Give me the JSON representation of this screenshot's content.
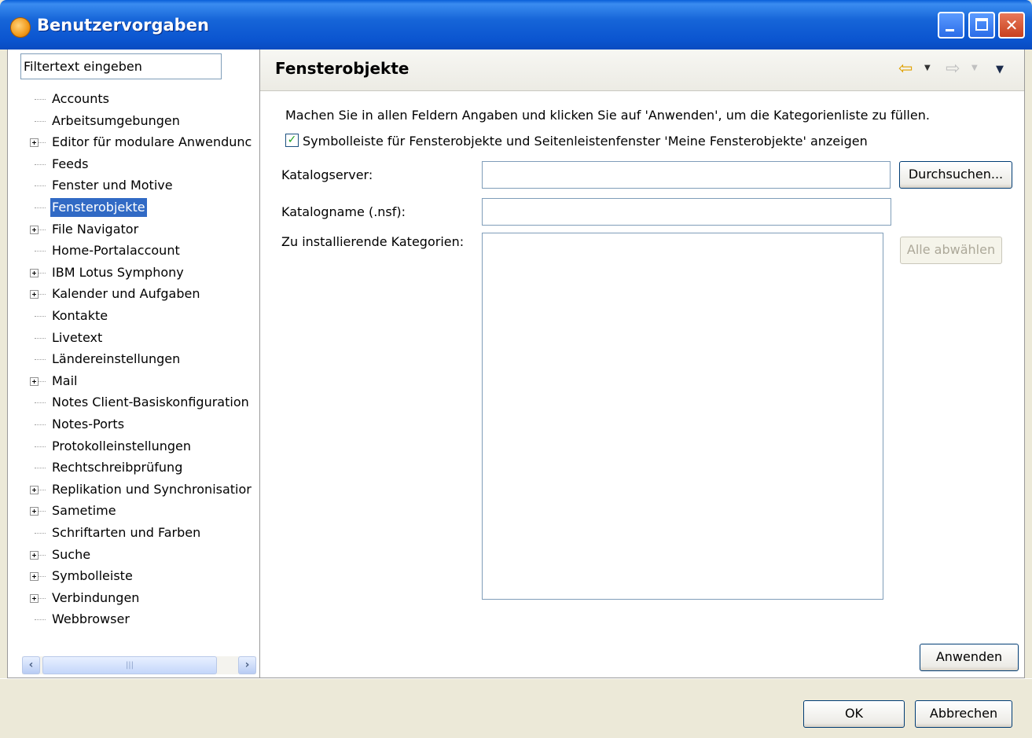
{
  "window": {
    "title": "Benutzervorgaben"
  },
  "filter": {
    "placeholder": "Filtertext eingeben"
  },
  "tree": {
    "items": [
      {
        "label": "Accounts",
        "expandable": false
      },
      {
        "label": "Arbeitsumgebungen",
        "expandable": false
      },
      {
        "label": "Editor für modulare Anwendunc",
        "expandable": true
      },
      {
        "label": "Feeds",
        "expandable": false
      },
      {
        "label": "Fenster und Motive",
        "expandable": false
      },
      {
        "label": "Fensterobjekte",
        "expandable": false,
        "selected": true
      },
      {
        "label": "File Navigator",
        "expandable": true
      },
      {
        "label": "Home-Portalaccount",
        "expandable": false
      },
      {
        "label": "IBM Lotus Symphony",
        "expandable": true
      },
      {
        "label": "Kalender und Aufgaben",
        "expandable": true
      },
      {
        "label": "Kontakte",
        "expandable": false
      },
      {
        "label": "Livetext",
        "expandable": false
      },
      {
        "label": "Ländereinstellungen",
        "expandable": false
      },
      {
        "label": "Mail",
        "expandable": true
      },
      {
        "label": "Notes Client-Basiskonfiguration",
        "expandable": false
      },
      {
        "label": "Notes-Ports",
        "expandable": false
      },
      {
        "label": "Protokolleinstellungen",
        "expandable": false
      },
      {
        "label": "Rechtschreibprüfung",
        "expandable": false
      },
      {
        "label": "Replikation und Synchronisatior",
        "expandable": true
      },
      {
        "label": "Sametime",
        "expandable": true
      },
      {
        "label": "Schriftarten und Farben",
        "expandable": false
      },
      {
        "label": "Suche",
        "expandable": true
      },
      {
        "label": "Symbolleiste",
        "expandable": true
      },
      {
        "label": "Verbindungen",
        "expandable": true
      },
      {
        "label": "Webbrowser",
        "expandable": false
      }
    ]
  },
  "page": {
    "title": "Fensterobjekte",
    "description": "Machen Sie in allen Feldern Angaben und klicken Sie auf 'Anwenden', um die Kategorienliste zu füllen.",
    "show_toolbar_checkbox": {
      "label": "Symbolleiste für Fensterobjekte und Seitenleistenfenster 'Meine Fensterobjekte' anzeigen",
      "checked": true
    },
    "catalog_server": {
      "label": "Katalogserver:",
      "value": ""
    },
    "browse_button": "Durchsuchen...",
    "catalog_name": {
      "label": "Katalogname (.nsf):",
      "value": ""
    },
    "categories": {
      "label": "Zu installierende Kategorien:",
      "items": []
    },
    "deselect_all_button": "Alle abwählen",
    "apply_button": "Anwenden"
  },
  "footer": {
    "ok_button": "OK",
    "cancel_button": "Abbrechen"
  },
  "icons": {
    "back": "back-arrow-icon",
    "forward": "forward-arrow-icon",
    "view_menu": "view-menu-icon"
  }
}
